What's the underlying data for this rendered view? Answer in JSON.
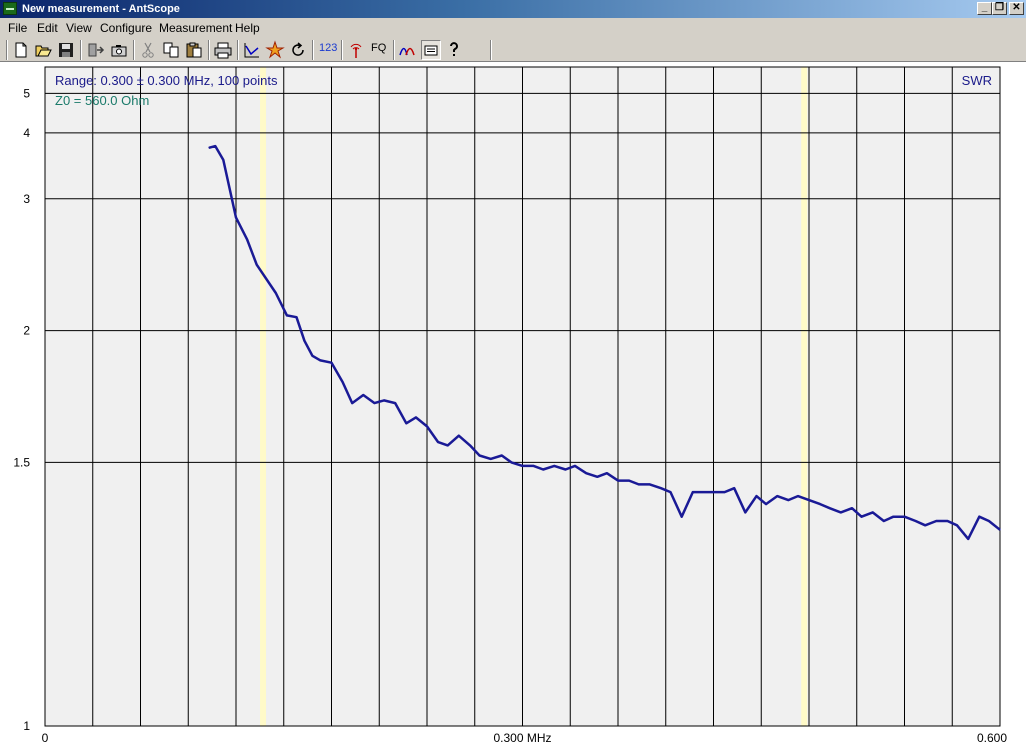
{
  "window": {
    "title": "New measurement - AntScope",
    "controls": {
      "minimize": "_",
      "restore": "❐",
      "close": "✕"
    }
  },
  "menu": {
    "items": [
      "File",
      "Edit",
      "View",
      "Configure",
      "Measurement",
      "Help"
    ]
  },
  "toolbar": {
    "groups": [
      [
        "new-icon",
        "open-icon",
        "save-icon"
      ],
      [
        "export-icon",
        "camera-icon"
      ],
      [
        "cut-icon",
        "copy-icon",
        "paste-icon"
      ],
      [
        "print-icon"
      ],
      [
        "graph-icon",
        "star-icon",
        "refresh-icon"
      ],
      [
        "digits-icon"
      ],
      [
        "antenna-icon",
        "fq-icon"
      ],
      [
        "curves-icon",
        "tabs-icon",
        "help-icon"
      ]
    ],
    "digits_label": "123",
    "fq_label": "FQ"
  },
  "chart_data": {
    "type": "line",
    "title": "",
    "range_text": "Range: 0.300 ± 0.300 MHz, 100 points",
    "z0_text": "Z0 = 560.0 Ohm",
    "series_label": "SWR",
    "x_tick_labels": [
      "0",
      "0.300 MHz",
      "0.600"
    ],
    "xlim": [
      0,
      0.6
    ],
    "y_ticks": [
      1,
      1.5,
      2,
      3,
      4,
      5
    ],
    "y_tick_labels": [
      "1",
      "1.5",
      "2",
      "3",
      "4",
      "5"
    ],
    "y_scale": "1 / SWR",
    "ylim": [
      1,
      6
    ],
    "grid": true,
    "vertical_grid_lines": 20,
    "markers_x": [
      0.137,
      0.477
    ],
    "colors": {
      "curve": "#1a1a96",
      "range_text": "#1a1a8a",
      "z0_text": "#1a7a6a",
      "background": "#f0f0f0",
      "grid": "#000000",
      "marker": "#fffac8"
    },
    "series": [
      {
        "name": "SWR",
        "x": [
          0.103,
          0.107,
          0.112,
          0.12,
          0.127,
          0.133,
          0.145,
          0.152,
          0.158,
          0.163,
          0.168,
          0.173,
          0.18,
          0.187,
          0.193,
          0.2,
          0.207,
          0.213,
          0.22,
          0.227,
          0.233,
          0.24,
          0.247,
          0.253,
          0.26,
          0.267,
          0.273,
          0.28,
          0.287,
          0.293,
          0.3,
          0.307,
          0.313,
          0.32,
          0.327,
          0.333,
          0.34,
          0.347,
          0.353,
          0.36,
          0.367,
          0.373,
          0.38,
          0.387,
          0.393,
          0.4,
          0.407,
          0.413,
          0.42,
          0.427,
          0.433,
          0.44,
          0.447,
          0.453,
          0.46,
          0.467,
          0.473,
          0.48,
          0.487,
          0.493,
          0.5,
          0.507,
          0.513,
          0.52,
          0.527,
          0.533,
          0.54,
          0.547,
          0.553,
          0.56,
          0.567,
          0.573,
          0.58,
          0.587,
          0.593,
          0.6
        ],
        "y": [
          3.72,
          3.75,
          3.52,
          2.8,
          2.6,
          2.4,
          2.21,
          2.08,
          2.07,
          1.95,
          1.88,
          1.86,
          1.85,
          1.77,
          1.69,
          1.72,
          1.69,
          1.7,
          1.69,
          1.62,
          1.64,
          1.61,
          1.56,
          1.55,
          1.58,
          1.55,
          1.52,
          1.51,
          1.52,
          1.5,
          1.49,
          1.49,
          1.48,
          1.49,
          1.48,
          1.49,
          1.47,
          1.46,
          1.47,
          1.45,
          1.45,
          1.44,
          1.44,
          1.43,
          1.42,
          1.36,
          1.42,
          1.42,
          1.42,
          1.42,
          1.43,
          1.37,
          1.41,
          1.39,
          1.41,
          1.4,
          1.41,
          1.4,
          1.39,
          1.38,
          1.37,
          1.38,
          1.36,
          1.37,
          1.35,
          1.36,
          1.36,
          1.35,
          1.34,
          1.35,
          1.35,
          1.34,
          1.31,
          1.36,
          1.35,
          1.33
        ]
      }
    ]
  }
}
